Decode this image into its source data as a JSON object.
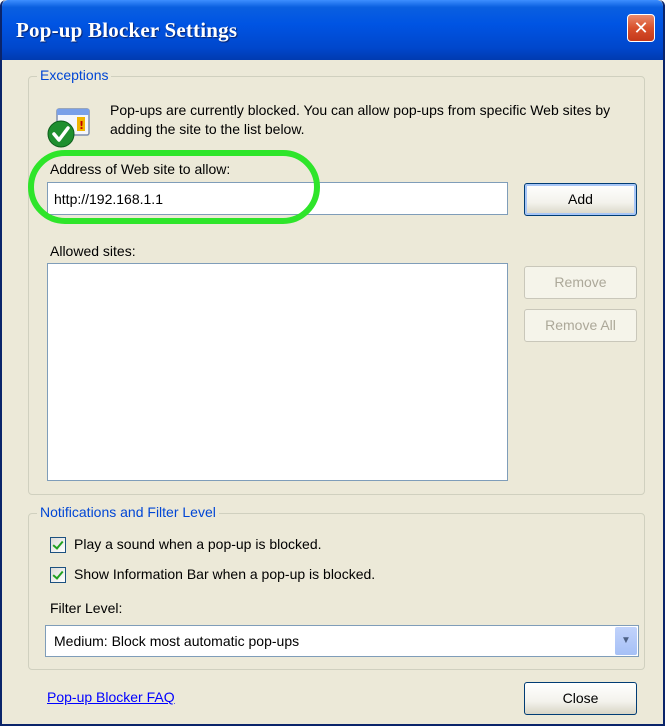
{
  "window": {
    "title": "Pop-up Blocker Settings",
    "close_glyph": "✕"
  },
  "exceptions": {
    "legend": "Exceptions",
    "info_icon": "shield-check-icon",
    "info_text": "Pop-ups are currently blocked.  You can allow pop-ups from specific Web sites by adding the site to the list below.",
    "address_label": "Address of Web site to allow:",
    "address_value": "http://192.168.1.1",
    "add_label": "Add",
    "allowed_label": "Allowed sites:",
    "allowed_sites": [],
    "remove_label": "Remove",
    "remove_all_label": "Remove All"
  },
  "notifications": {
    "legend": "Notifications and Filter Level",
    "play_sound_label": "Play a sound when a pop-up is blocked.",
    "play_sound_checked": true,
    "info_bar_label": "Show Information Bar when a pop-up is blocked.",
    "info_bar_checked": true,
    "filter_label": "Filter Level:",
    "filter_value": "Medium: Block most automatic pop-ups",
    "filter_arrow": "▼"
  },
  "footer": {
    "faq_link": "Pop-up Blocker FAQ",
    "close_label": "Close"
  },
  "colors": {
    "titlebar": "#0054e3",
    "legend_text": "#0046d5",
    "highlight_ring": "#2ee52a",
    "dialog_bg": "#ece9d8"
  }
}
